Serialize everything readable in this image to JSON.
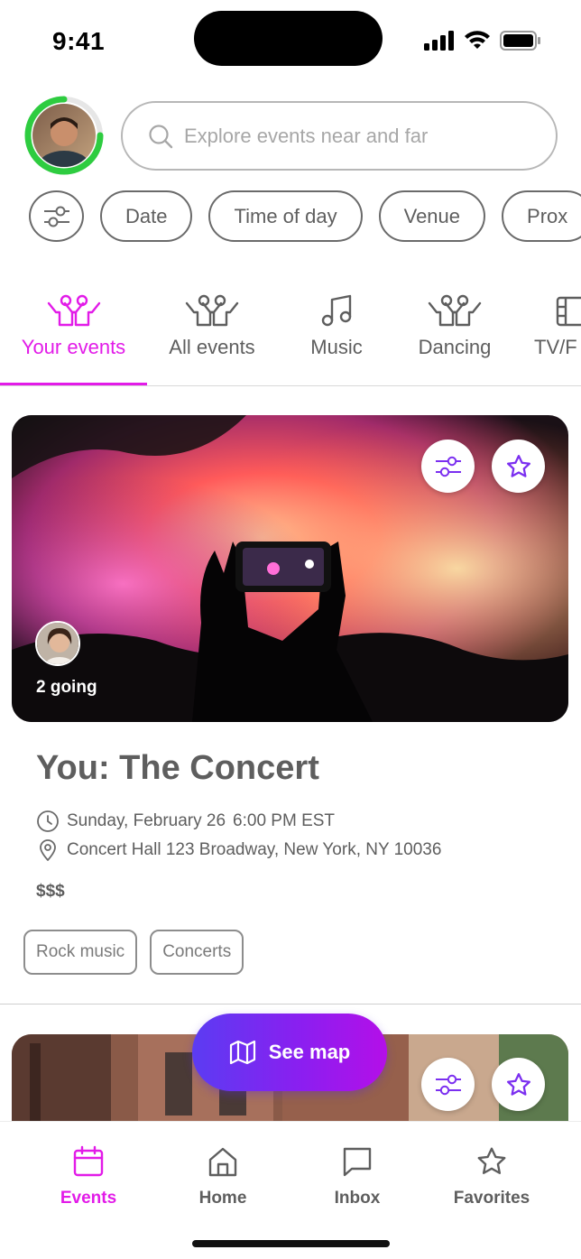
{
  "status": {
    "time": "9:41"
  },
  "search": {
    "placeholder": "Explore events near and far"
  },
  "filters": {
    "chips": [
      "Date",
      "Time of day",
      "Venue",
      "Prox"
    ]
  },
  "categories": [
    {
      "label": "Your events",
      "icon": "people-icon",
      "active": true
    },
    {
      "label": "All events",
      "icon": "people-icon",
      "active": false
    },
    {
      "label": "Music",
      "icon": "music-note-icon",
      "active": false
    },
    {
      "label": "Dancing",
      "icon": "people-icon",
      "active": false
    },
    {
      "label": "TV/F",
      "icon": "film-icon",
      "active": false
    }
  ],
  "event": {
    "going": "2 going",
    "title": "You: The Concert",
    "date": "Sunday, February 26",
    "time": "6:00 PM EST",
    "location": "Concert Hall 123 Broadway, New York, NY 10036",
    "price": "$$$",
    "tags": [
      "Rock music",
      "Concerts"
    ]
  },
  "see_map": {
    "label": "See map"
  },
  "tabbar": {
    "tabs": [
      {
        "label": "Events",
        "icon": "calendar-icon",
        "active": true
      },
      {
        "label": "Home",
        "icon": "home-icon",
        "active": false
      },
      {
        "label": "Inbox",
        "icon": "chat-bubble-icon",
        "active": false
      },
      {
        "label": "Favorites",
        "icon": "star-icon",
        "active": false
      }
    ]
  },
  "colors": {
    "accent": "#e21be8",
    "button_start": "#5b3cf2",
    "button_end": "#b40fe8",
    "progress_ring": "#2ecc40",
    "star_purple": "#7b2ff0"
  }
}
